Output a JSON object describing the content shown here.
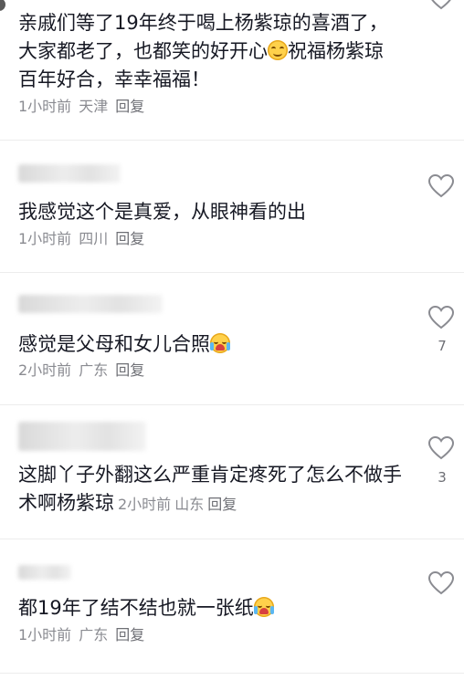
{
  "comments": [
    {
      "text": "亲戚们等了19年终于喝上杨紫琼的喜酒了，大家都老了，也都笑的好开心",
      "text_tail": "祝福杨紫琼百年好合，幸幸福福！",
      "emoji": "smile-emoji",
      "time": "1小时前",
      "location": "天津",
      "reply": "回复",
      "likes": ""
    },
    {
      "text": "我感觉这个是真爱，从眼神看的出",
      "time": "1小时前",
      "location": "四川",
      "reply": "回复",
      "likes": ""
    },
    {
      "text": "感觉是父母和女儿合照",
      "emoji": "crying-laughing-emoji",
      "time": "2小时前",
      "location": "广东",
      "reply": "回复",
      "likes": "7"
    },
    {
      "text": "这脚丫子外翻这么严重肯定疼死了怎么不做手术啊杨紫琼",
      "time": "2小时前",
      "location": "山东",
      "reply": "回复",
      "likes": "3"
    },
    {
      "text": "都19年了结不结也就一张纸",
      "emoji": "crying-laughing-emoji",
      "time": "1小时前",
      "location": "广东",
      "reply": "回复",
      "likes": ""
    }
  ],
  "icons": {
    "like": "heart-outline-icon"
  },
  "colors": {
    "text": "#161823",
    "meta": "#8a8b91",
    "divider": "#ececec"
  }
}
